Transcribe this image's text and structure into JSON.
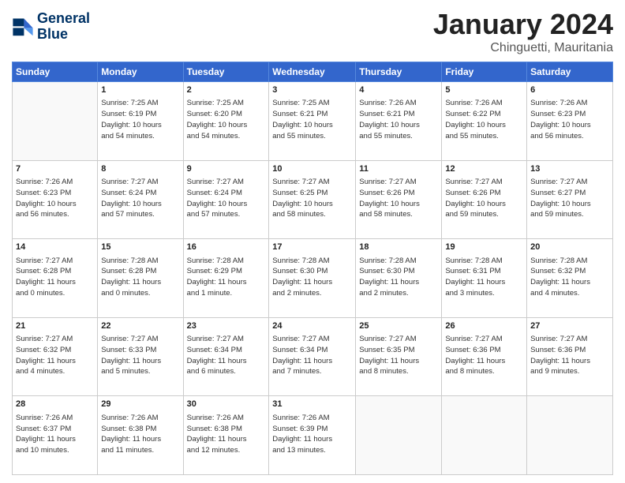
{
  "logo": {
    "line1": "General",
    "line2": "Blue"
  },
  "title": "January 2024",
  "subtitle": "Chinguetti, Mauritania",
  "weekdays": [
    "Sunday",
    "Monday",
    "Tuesday",
    "Wednesday",
    "Thursday",
    "Friday",
    "Saturday"
  ],
  "weeks": [
    [
      {
        "day": "",
        "info": ""
      },
      {
        "day": "1",
        "info": "Sunrise: 7:25 AM\nSunset: 6:19 PM\nDaylight: 10 hours\nand 54 minutes."
      },
      {
        "day": "2",
        "info": "Sunrise: 7:25 AM\nSunset: 6:20 PM\nDaylight: 10 hours\nand 54 minutes."
      },
      {
        "day": "3",
        "info": "Sunrise: 7:25 AM\nSunset: 6:21 PM\nDaylight: 10 hours\nand 55 minutes."
      },
      {
        "day": "4",
        "info": "Sunrise: 7:26 AM\nSunset: 6:21 PM\nDaylight: 10 hours\nand 55 minutes."
      },
      {
        "day": "5",
        "info": "Sunrise: 7:26 AM\nSunset: 6:22 PM\nDaylight: 10 hours\nand 55 minutes."
      },
      {
        "day": "6",
        "info": "Sunrise: 7:26 AM\nSunset: 6:23 PM\nDaylight: 10 hours\nand 56 minutes."
      }
    ],
    [
      {
        "day": "7",
        "info": "Sunrise: 7:26 AM\nSunset: 6:23 PM\nDaylight: 10 hours\nand 56 minutes."
      },
      {
        "day": "8",
        "info": "Sunrise: 7:27 AM\nSunset: 6:24 PM\nDaylight: 10 hours\nand 57 minutes."
      },
      {
        "day": "9",
        "info": "Sunrise: 7:27 AM\nSunset: 6:24 PM\nDaylight: 10 hours\nand 57 minutes."
      },
      {
        "day": "10",
        "info": "Sunrise: 7:27 AM\nSunset: 6:25 PM\nDaylight: 10 hours\nand 58 minutes."
      },
      {
        "day": "11",
        "info": "Sunrise: 7:27 AM\nSunset: 6:26 PM\nDaylight: 10 hours\nand 58 minutes."
      },
      {
        "day": "12",
        "info": "Sunrise: 7:27 AM\nSunset: 6:26 PM\nDaylight: 10 hours\nand 59 minutes."
      },
      {
        "day": "13",
        "info": "Sunrise: 7:27 AM\nSunset: 6:27 PM\nDaylight: 10 hours\nand 59 minutes."
      }
    ],
    [
      {
        "day": "14",
        "info": "Sunrise: 7:27 AM\nSunset: 6:28 PM\nDaylight: 11 hours\nand 0 minutes."
      },
      {
        "day": "15",
        "info": "Sunrise: 7:28 AM\nSunset: 6:28 PM\nDaylight: 11 hours\nand 0 minutes."
      },
      {
        "day": "16",
        "info": "Sunrise: 7:28 AM\nSunset: 6:29 PM\nDaylight: 11 hours\nand 1 minute."
      },
      {
        "day": "17",
        "info": "Sunrise: 7:28 AM\nSunset: 6:30 PM\nDaylight: 11 hours\nand 2 minutes."
      },
      {
        "day": "18",
        "info": "Sunrise: 7:28 AM\nSunset: 6:30 PM\nDaylight: 11 hours\nand 2 minutes."
      },
      {
        "day": "19",
        "info": "Sunrise: 7:28 AM\nSunset: 6:31 PM\nDaylight: 11 hours\nand 3 minutes."
      },
      {
        "day": "20",
        "info": "Sunrise: 7:28 AM\nSunset: 6:32 PM\nDaylight: 11 hours\nand 4 minutes."
      }
    ],
    [
      {
        "day": "21",
        "info": "Sunrise: 7:27 AM\nSunset: 6:32 PM\nDaylight: 11 hours\nand 4 minutes."
      },
      {
        "day": "22",
        "info": "Sunrise: 7:27 AM\nSunset: 6:33 PM\nDaylight: 11 hours\nand 5 minutes."
      },
      {
        "day": "23",
        "info": "Sunrise: 7:27 AM\nSunset: 6:34 PM\nDaylight: 11 hours\nand 6 minutes."
      },
      {
        "day": "24",
        "info": "Sunrise: 7:27 AM\nSunset: 6:34 PM\nDaylight: 11 hours\nand 7 minutes."
      },
      {
        "day": "25",
        "info": "Sunrise: 7:27 AM\nSunset: 6:35 PM\nDaylight: 11 hours\nand 8 minutes."
      },
      {
        "day": "26",
        "info": "Sunrise: 7:27 AM\nSunset: 6:36 PM\nDaylight: 11 hours\nand 8 minutes."
      },
      {
        "day": "27",
        "info": "Sunrise: 7:27 AM\nSunset: 6:36 PM\nDaylight: 11 hours\nand 9 minutes."
      }
    ],
    [
      {
        "day": "28",
        "info": "Sunrise: 7:26 AM\nSunset: 6:37 PM\nDaylight: 11 hours\nand 10 minutes."
      },
      {
        "day": "29",
        "info": "Sunrise: 7:26 AM\nSunset: 6:38 PM\nDaylight: 11 hours\nand 11 minutes."
      },
      {
        "day": "30",
        "info": "Sunrise: 7:26 AM\nSunset: 6:38 PM\nDaylight: 11 hours\nand 12 minutes."
      },
      {
        "day": "31",
        "info": "Sunrise: 7:26 AM\nSunset: 6:39 PM\nDaylight: 11 hours\nand 13 minutes."
      },
      {
        "day": "",
        "info": ""
      },
      {
        "day": "",
        "info": ""
      },
      {
        "day": "",
        "info": ""
      }
    ]
  ]
}
